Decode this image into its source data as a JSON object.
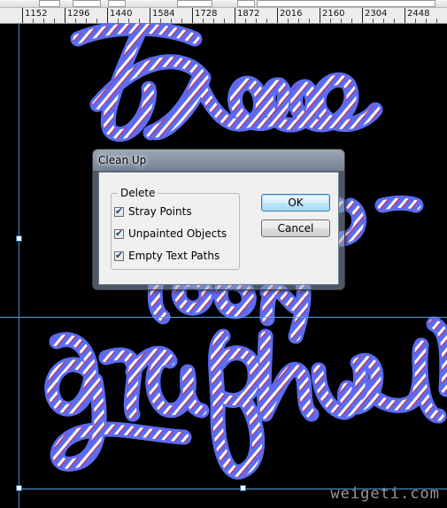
{
  "ruler": {
    "labels": [
      "1152",
      "1296",
      "1440",
      "1584",
      "1728",
      "1872",
      "2016",
      "2160",
      "2304",
      "2448"
    ]
  },
  "dialog": {
    "title": "Clean Up",
    "group_label": "Delete",
    "options": [
      {
        "label": "Stray Points",
        "checked": true
      },
      {
        "label": "Unpainted Objects",
        "checked": true
      },
      {
        "label": "Empty Text Paths",
        "checked": true
      }
    ],
    "ok_label": "OK",
    "cancel_label": "Cancel"
  },
  "artwork": {
    "background_color": "#000000",
    "rope_color": "#5b6cf2",
    "stripe_white": "#ffffff",
    "stripe_red": "#c0306a",
    "guide_color": "#4da3e8"
  },
  "watermark": "weigeti.com"
}
